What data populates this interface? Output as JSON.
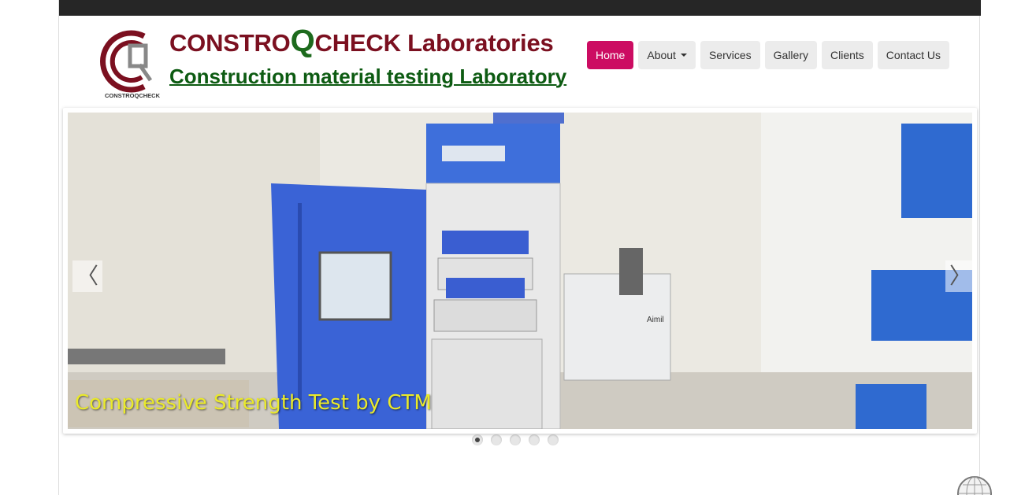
{
  "brand": {
    "title_prefix": "CONSTRO",
    "title_q": "Q",
    "title_suffix": "CHECK Laboratories",
    "subtitle": "Construction material testing Laboratory",
    "logo_text": "CONSTROQCHECK"
  },
  "nav": {
    "items": [
      {
        "label": "Home",
        "active": true
      },
      {
        "label": "About",
        "dropdown": true
      },
      {
        "label": "Services"
      },
      {
        "label": "Gallery"
      },
      {
        "label": "Clients"
      },
      {
        "label": "Contact Us"
      }
    ]
  },
  "carousel": {
    "caption": "Compressive Strength Test by CTM",
    "prev_icon": "chevron-left-icon",
    "next_icon": "chevron-right-icon",
    "prev_glyph": "〈",
    "next_glyph": "〉",
    "slide_count": 5,
    "active_index": 0,
    "equipment_label": "Aimil"
  },
  "colors": {
    "accent": "#cc0c62",
    "brand_red": "#7b1020",
    "brand_green": "#0d5b12",
    "caption": "#eaea2a"
  }
}
